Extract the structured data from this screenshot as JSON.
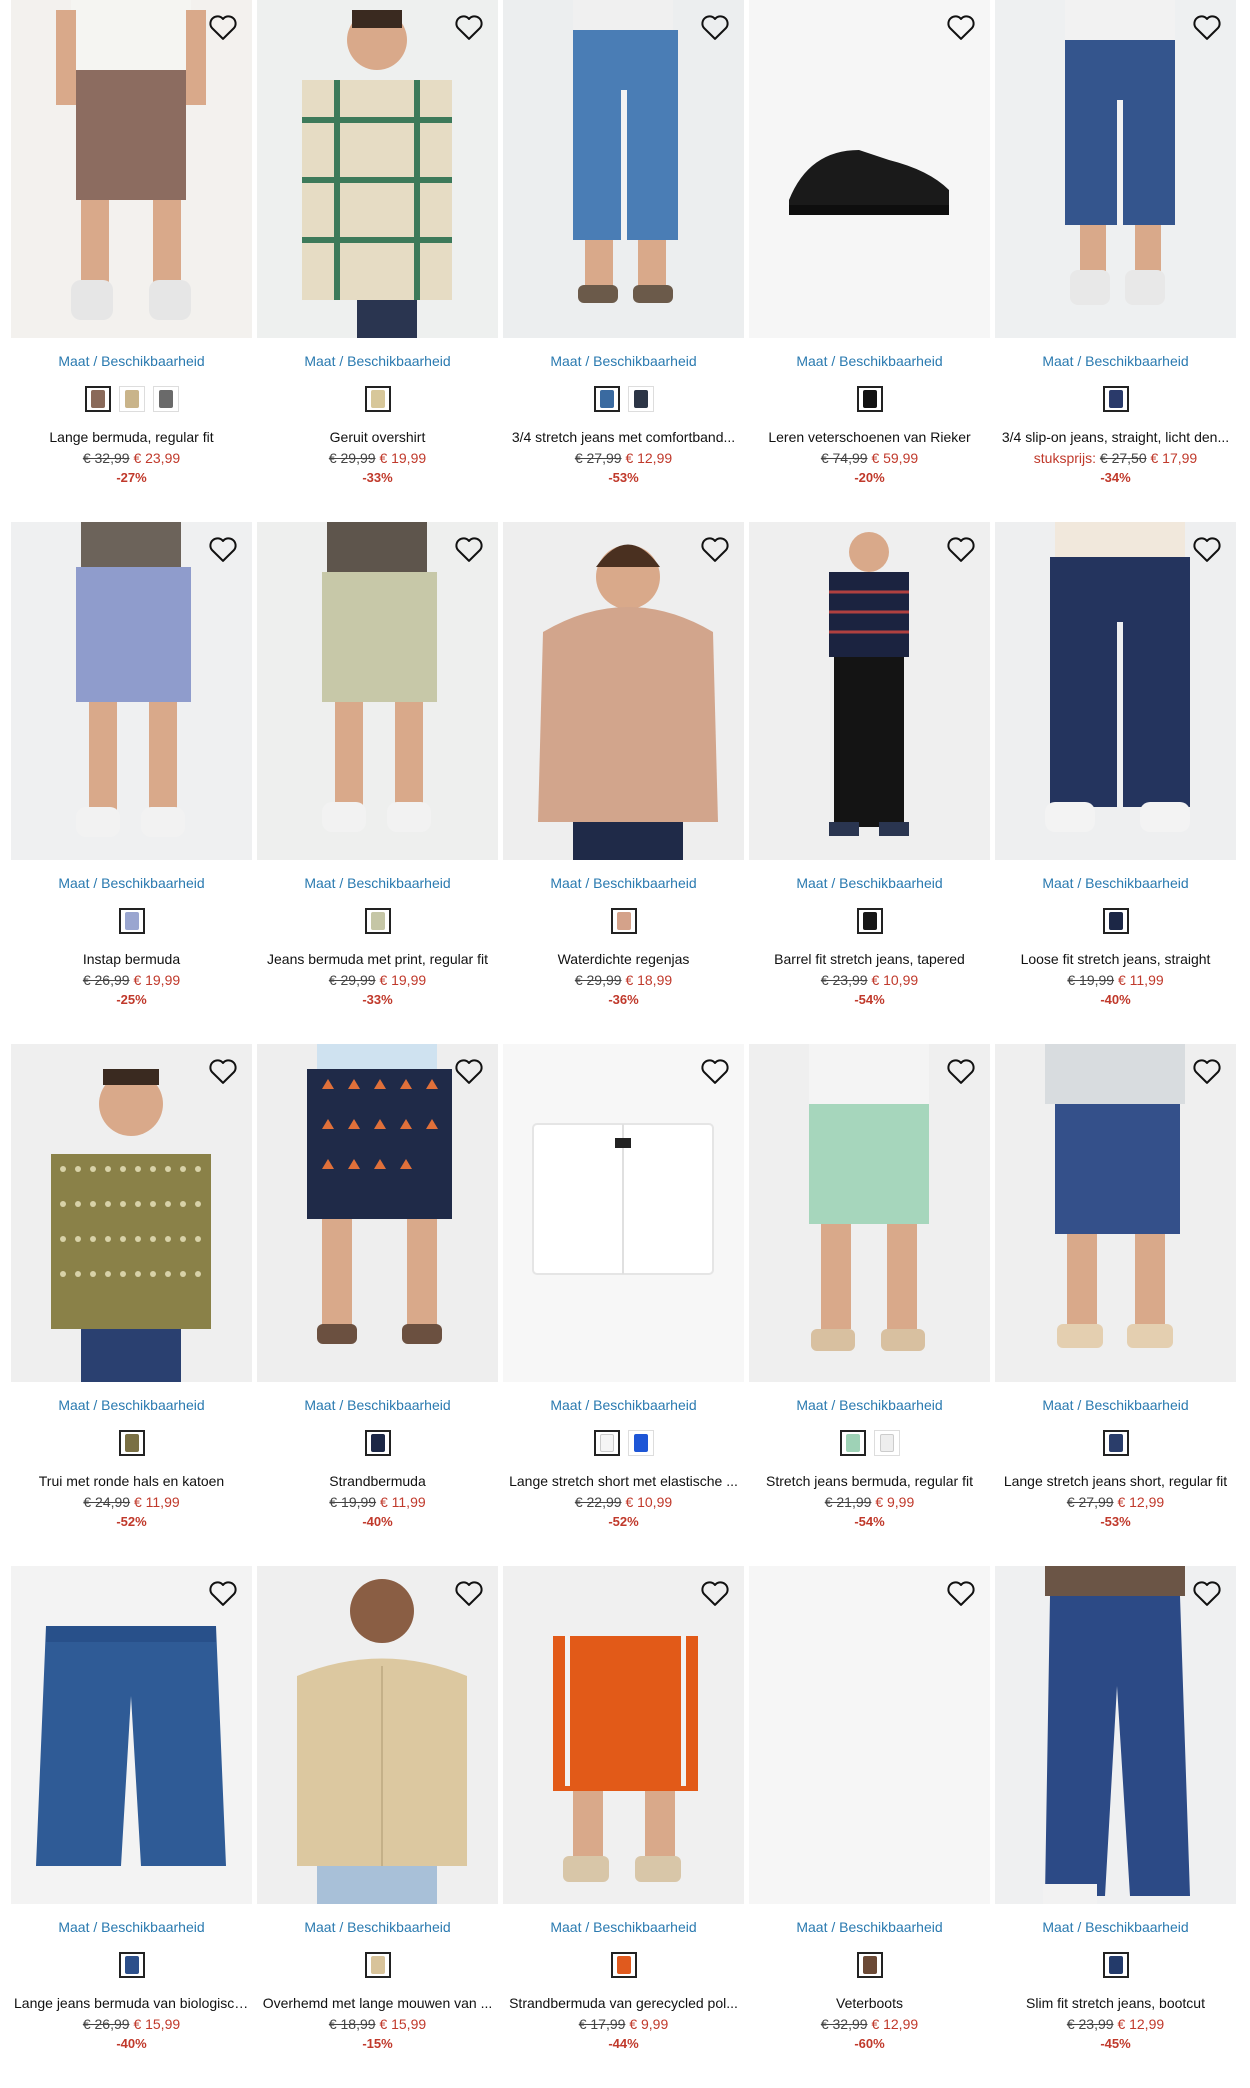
{
  "link_label": "Maat / Beschikbaarheid",
  "products": [
    {
      "name": "Lange bermuda, regular fit",
      "old_price": "€ 32,99",
      "new_price": "€ 23,99",
      "discount": "-27%",
      "image": "cargo-bermuda",
      "colors": [
        "#8a6a5a",
        "#c9b48a",
        "#6a6a6a"
      ],
      "bg": "#f3f1ee"
    },
    {
      "name": "Geruit overshirt",
      "old_price": "€ 29,99",
      "new_price": "€ 19,99",
      "discount": "-33%",
      "image": "plaid-shirt",
      "colors": [
        "#d7c79a"
      ],
      "bg": "#eef0ef"
    },
    {
      "name": "3/4 stretch jeans met comfortband...",
      "old_price": "€ 27,99",
      "new_price": "€ 12,99",
      "discount": "-53%",
      "image": "denim-capri",
      "colors": [
        "#3a6aa0",
        "#2c3546"
      ],
      "bg": "#eceeef"
    },
    {
      "name": "Leren veterschoenen van Rieker",
      "old_price": "€ 74,99",
      "new_price": "€ 59,99",
      "discount": "-20%",
      "image": "shoe",
      "colors": [
        "#111111"
      ],
      "bg": "#f6f6f6"
    },
    {
      "name": "3/4 slip-on jeans, straight, licht den...",
      "prefix": "stuksprijs:",
      "old_price": "€ 27,50",
      "new_price": "€ 17,99",
      "discount": "-34%",
      "image": "denim-capri-dark",
      "colors": [
        "#2a3a6a"
      ],
      "bg": "#eef0f1"
    },
    {
      "name": "Instap bermuda",
      "old_price": "€ 26,99",
      "new_price": "€ 19,99",
      "discount": "-25%",
      "image": "blue-shorts",
      "colors": [
        "#9aa6d0"
      ],
      "bg": "#eff0f1"
    },
    {
      "name": "Jeans bermuda met print, regular fit",
      "old_price": "€ 29,99",
      "new_price": "€ 19,99",
      "discount": "-33%",
      "image": "sage-shorts",
      "colors": [
        "#c5c6a6"
      ],
      "bg": "#eeefee"
    },
    {
      "name": "Waterdichte regenjas",
      "old_price": "€ 29,99",
      "new_price": "€ 18,99",
      "discount": "-36%",
      "image": "jacket",
      "colors": [
        "#d4a28a"
      ],
      "bg": "#eeeeee"
    },
    {
      "name": "Barrel fit stretch jeans, tapered",
      "old_price": "€ 23,99",
      "new_price": "€ 10,99",
      "discount": "-54%",
      "image": "black-jeans",
      "colors": [
        "#161616"
      ],
      "bg": "#efefef"
    },
    {
      "name": "Loose fit stretch jeans, straight",
      "old_price": "€ 19,99",
      "new_price": "€ 11,99",
      "discount": "-40%",
      "image": "navy-jeans",
      "colors": [
        "#1c2746"
      ],
      "bg": "#eeeff0"
    },
    {
      "name": "Trui met ronde hals en katoen",
      "old_price": "€ 24,99",
      "new_price": "€ 11,99",
      "discount": "-52%",
      "image": "knit",
      "colors": [
        "#7a7044"
      ],
      "bg": "#efefef"
    },
    {
      "name": "Strandbermuda",
      "old_price": "€ 19,99",
      "new_price": "€ 11,99",
      "discount": "-40%",
      "image": "navy-print-shorts",
      "colors": [
        "#1c2746"
      ],
      "bg": "#eeeeee"
    },
    {
      "name": "Lange stretch short met elastische ...",
      "old_price": "€ 22,99",
      "new_price": "€ 10,99",
      "discount": "-52%",
      "image": "white-shorts",
      "colors": [
        "#f5f5f5",
        "#1e56d6"
      ],
      "bg": "#f7f7f7"
    },
    {
      "name": "Stretch jeans bermuda, regular fit",
      "old_price": "€ 21,99",
      "new_price": "€ 9,99",
      "discount": "-54%",
      "image": "mint-shorts",
      "colors": [
        "#9ed2b6",
        "#eeeeee"
      ],
      "bg": "#efefef"
    },
    {
      "name": "Lange stretch jeans short, regular fit",
      "old_price": "€ 27,99",
      "new_price": "€ 12,99",
      "discount": "-53%",
      "image": "denim-shorts",
      "colors": [
        "#2a3d6a"
      ],
      "bg": "#efefef"
    },
    {
      "name": "Lange jeans bermuda van biologisch...",
      "old_price": "€ 26,99",
      "new_price": "€ 15,99",
      "discount": "-40%",
      "image": "jeans-bermuda-flat",
      "colors": [
        "#2c4f8a"
      ],
      "bg": "#f3f3f3"
    },
    {
      "name": "Overhemd met lange mouwen van ...",
      "old_price": "€ 18,99",
      "new_price": "€ 15,99",
      "discount": "-15%",
      "image": "beige-shirt",
      "colors": [
        "#d8c39a"
      ],
      "bg": "#efefef"
    },
    {
      "name": "Strandbermuda van gerecycled pol...",
      "old_price": "€ 17,99",
      "new_price": "€ 9,99",
      "discount": "-44%",
      "image": "orange-shorts",
      "colors": [
        "#e05a1e"
      ],
      "bg": "#f0f0f0"
    },
    {
      "name": "Veterboots",
      "old_price": "€ 32,99",
      "new_price": "€ 12,99",
      "discount": "-60%",
      "image": "blank",
      "colors": [
        "#6b4a36"
      ],
      "bg": "#f6f6f6"
    },
    {
      "name": "Slim fit stretch jeans, bootcut",
      "old_price": "€ 23,99",
      "new_price": "€ 12,99",
      "discount": "-45%",
      "image": "bootcut-jeans",
      "colors": [
        "#233a6a"
      ],
      "bg": "#eff0f1"
    }
  ]
}
